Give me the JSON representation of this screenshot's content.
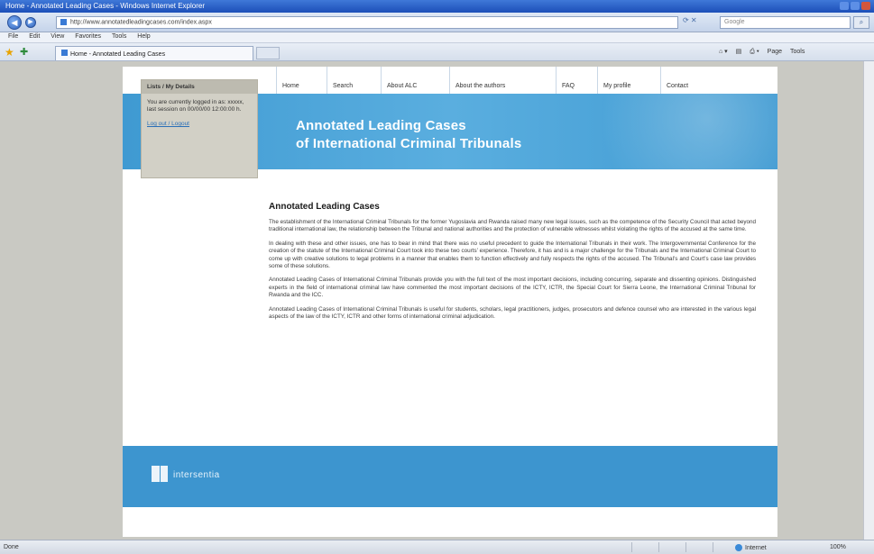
{
  "window": {
    "title": "Home - Annotated Leading Cases - Windows Internet Explorer"
  },
  "address": {
    "url": "http://www.annotatedleadingcases.com/index.aspx",
    "search_placeholder": "Google"
  },
  "menu": [
    "File",
    "Edit",
    "View",
    "Favorites",
    "Tools",
    "Help"
  ],
  "tab": {
    "label": "Home - Annotated Leading Cases"
  },
  "commands": [
    "Page",
    "Tools"
  ],
  "site": {
    "nav": [
      "Home",
      "Search",
      "About ALC",
      "About the authors",
      "FAQ",
      "My profile",
      "Contact"
    ],
    "login": {
      "heading": "Lists / My Details",
      "message": "You are currently logged in as: xxxxx, last session on 00/00/00 12:00:00 h.",
      "link": "Log out / Logout"
    },
    "banner": {
      "line1": "Annotated Leading Cases",
      "line2": "of International Criminal Tribunals"
    },
    "heading": "Annotated Leading Cases",
    "paragraphs": [
      "The establishment of the International Criminal Tribunals for the former Yugoslavia and Rwanda raised many new legal issues, such as the competence of the Security Council that acted beyond traditional international law, the relationship between the Tribunal and national authorities and the protection of vulnerable witnesses whilst violating the rights of the accused at the same time.",
      "In dealing with these and other issues, one has to bear in mind that there was no useful precedent to guide the International Tribunals in their work. The Intergovernmental Conference for the creation of the statute of the International Criminal Court took into these two courts’ experience. Therefore, it has and is a major challenge for the Tribunals and the International Criminal Court to come up with creative solutions to legal problems in a manner that enables them to function effectively and fully respects the rights of the accused. The Tribunal’s and Court’s case law provides some of these solutions.",
      "Annotated Leading Cases of International Criminal Tribunals provide you with the full text of the most important decisions, including concurring, separate and dissenting opinions. Distinguished experts in the field of international criminal law have commented the most important decisions of the ICTY, ICTR, the Special Court for Sierra Leone, the International Criminal Tribunal for Rwanda and the ICC.",
      "Annotated Leading Cases of International Criminal Tribunals is useful for students, scholars, legal practitioners, judges, prosecutors and defence counsel who are interested in the various legal aspects of the law of the ICTY, ICTR and other forms of international criminal adjudication."
    ],
    "footer_logo": "intersentia"
  },
  "status": {
    "left": "Done",
    "zone": "Internet",
    "zoom": "100%"
  }
}
